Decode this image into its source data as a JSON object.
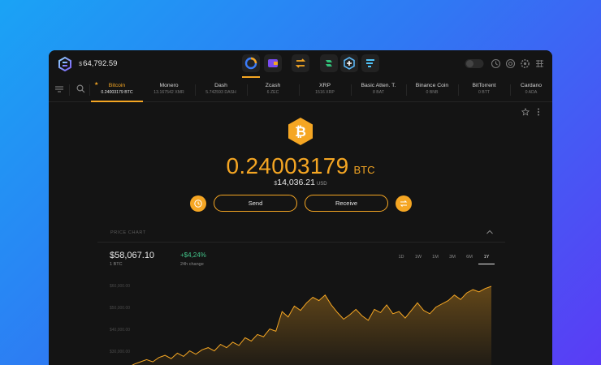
{
  "header": {
    "currency_symbol": "$",
    "total_balance": "64,792.59",
    "apps": [
      "portfolio-icon",
      "wallet-icon",
      "exchange-icon",
      "app-icon-1",
      "app-icon-2",
      "app-icon-3"
    ],
    "right_icons": [
      "privacy-toggle-icon",
      "history-icon",
      "help-icon",
      "settings-icon",
      "grid-icon"
    ]
  },
  "coins": [
    {
      "name": "Bitcoin",
      "amount": "0.24003179 BTC"
    },
    {
      "name": "Monero",
      "amount": "13.167542 XMR"
    },
    {
      "name": "Dash",
      "amount": "5.742593 DASH"
    },
    {
      "name": "Zcash",
      "amount": "6 ZEC"
    },
    {
      "name": "XRP",
      "amount": "1516 XRP"
    },
    {
      "name": "Basic Atten. T.",
      "amount": "8 BAT"
    },
    {
      "name": "Binance Coin",
      "amount": "0 BNB"
    },
    {
      "name": "BitTorrent",
      "amount": "0 BTT"
    },
    {
      "name": "Cardano",
      "amount": "0 ADA"
    }
  ],
  "asset": {
    "balance": "0.24003179",
    "ticker": "BTC",
    "fiat_symbol": "$",
    "fiat_value": "14,036.21",
    "fiat_unit": "USD",
    "send_label": "Send",
    "receive_label": "Receive"
  },
  "price_chart": {
    "section_label": "PRICE CHART",
    "price": "$58,067.10",
    "price_sub": "1 BTC",
    "change": "+$4,24%",
    "change_sub": "24h change",
    "ranges": [
      "1D",
      "1W",
      "1M",
      "3M",
      "6M",
      "1Y"
    ],
    "active_range": "1Y",
    "y_labels": [
      "$60,000.00",
      "$50,000.00",
      "$40,000.00",
      "$30,000.00"
    ]
  },
  "chart_data": {
    "type": "area",
    "color": "#f5a623",
    "ylim": [
      25000,
      62000
    ],
    "values": [
      20500,
      21500,
      22500,
      23000,
      24500,
      25500,
      26500,
      25500,
      27500,
      28500,
      27000,
      29500,
      28000,
      30500,
      29000,
      31000,
      32000,
      30500,
      33500,
      32000,
      34500,
      33000,
      36500,
      35000,
      38000,
      37000,
      40500,
      39500,
      48500,
      46000,
      51000,
      49000,
      52500,
      55000,
      53500,
      56000,
      51500,
      48000,
      45000,
      47000,
      49500,
      46500,
      44500,
      49500,
      48000,
      51500,
      47500,
      48500,
      45500,
      49000,
      52500,
      49000,
      47500,
      50500,
      52000,
      53500,
      56000,
      54000,
      57000,
      58500,
      57500,
      59000,
      60000
    ]
  }
}
